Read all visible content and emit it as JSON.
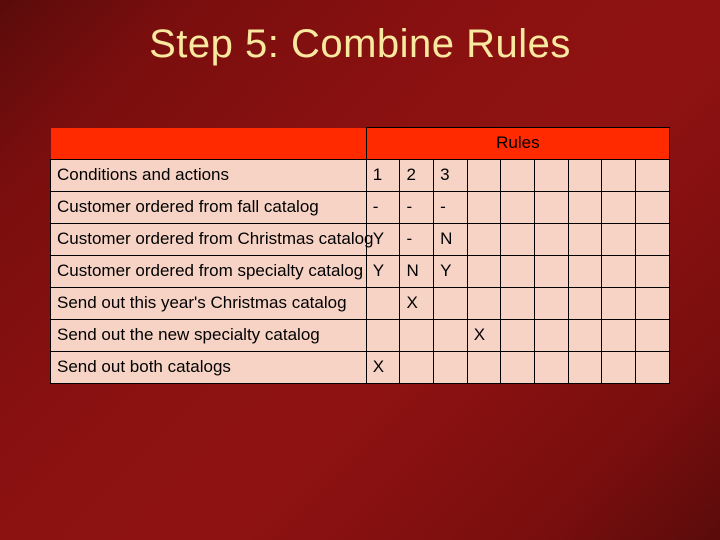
{
  "title": "Step 5: Combine Rules",
  "table": {
    "header_label": "Rules",
    "rows": [
      {
        "label": "Conditions and actions",
        "cells": [
          "1",
          "2",
          "3",
          "",
          "",
          "",
          "",
          "",
          ""
        ]
      },
      {
        "label": "Customer ordered from fall catalog",
        "cells": [
          "-",
          "-",
          "-",
          "",
          "",
          "",
          "",
          "",
          ""
        ]
      },
      {
        "label": "Customer ordered from Christmas catalog",
        "cells": [
          "Y",
          "-",
          "N",
          "",
          "",
          "",
          "",
          "",
          ""
        ]
      },
      {
        "label": "Customer ordered from specialty catalog",
        "cells": [
          "Y",
          "N",
          "Y",
          "",
          "",
          "",
          "",
          "",
          ""
        ]
      },
      {
        "label": "Send out this year's Christmas catalog",
        "cells": [
          "",
          "X",
          "",
          "",
          "",
          "",
          "",
          "",
          ""
        ]
      },
      {
        "label": "Send out the new specialty catalog",
        "cells": [
          "",
          "",
          "",
          "X",
          "",
          "",
          "",
          "",
          ""
        ]
      },
      {
        "label": "Send out both catalogs",
        "cells": [
          "X",
          "",
          "",
          "",
          "",
          "",
          "",
          "",
          ""
        ]
      }
    ]
  }
}
